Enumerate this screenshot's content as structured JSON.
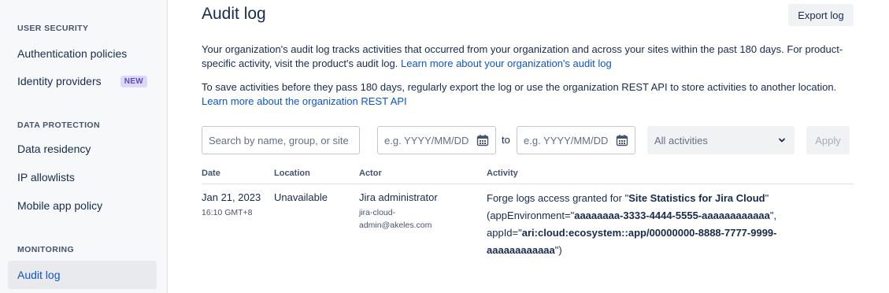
{
  "sidebar": {
    "sections": [
      {
        "heading": "USER SECURITY"
      },
      {
        "heading": "DATA PROTECTION"
      },
      {
        "heading": "MONITORING"
      }
    ],
    "items": [
      {
        "label": "Authentication policies"
      },
      {
        "label": "Identity providers",
        "badge": "NEW"
      },
      {
        "label": "Data residency"
      },
      {
        "label": "IP allowlists"
      },
      {
        "label": "Mobile app policy"
      },
      {
        "label": "Audit log",
        "active": true
      }
    ]
  },
  "header": {
    "title": "Audit log",
    "export_label": "Export log"
  },
  "intro": {
    "p1_text": "Your organization's audit log tracks activities that occurred from your organization and across your sites within the past 180 days. For product-specific activity, visit the product's audit log.",
    "p1_link": "Learn more about your organization's audit log",
    "p2_text": "To save activities before they pass 180 days, regularly export the log or use the organization REST API to store activities to another location.",
    "p2_link": "Learn more about the organization REST API"
  },
  "filters": {
    "search_placeholder": "Search by name, group, or site",
    "date_from_placeholder": "e.g. YYYY/MM/DD",
    "to_label": "to",
    "date_to_placeholder": "e.g. YYYY/MM/DD",
    "activity_select": "All activities",
    "apply_label": "Apply"
  },
  "table": {
    "columns": [
      "Date",
      "Location",
      "Actor",
      "Activity"
    ],
    "rows": [
      {
        "date": "Jan 21, 2023",
        "time": "16:10 GMT+8",
        "location": "Unavailable",
        "actor": "Jira administrator",
        "actor_email_1": "jira-cloud-",
        "actor_email_2": "admin@akeles.com",
        "activity_prefix": "Forge logs access granted for \"",
        "activity_app": "Site Statistics for Jira Cloud",
        "activity_mid1": "\" (appEnvironment=\"",
        "activity_env": "aaaaaaaa-3333-4444-5555-aaaaaaaaaaaa",
        "activity_mid2": "\", appId=\"",
        "activity_appid": "ari:cloud:ecosystem::app/00000000-8888-7777-9999-aaaaaaaaaaaa",
        "activity_suffix": "\")"
      }
    ]
  },
  "colors": {
    "accent": "#0c55cf",
    "sidebar_bg": "#f7f8f9",
    "badge_bg": "#dfd8fd",
    "badge_text": "#5e4db2"
  }
}
